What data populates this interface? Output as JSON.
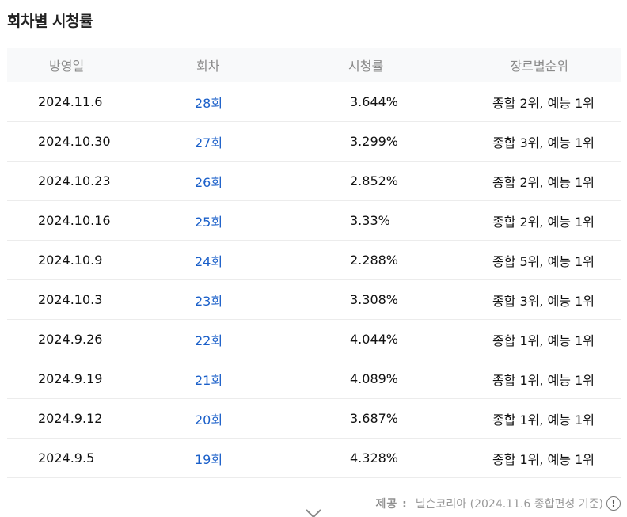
{
  "title": "회차별 시청률",
  "table": {
    "headers": [
      "방영일",
      "회차",
      "시청률",
      "장르별순위"
    ],
    "rows": [
      {
        "date": "2024.11.6",
        "episode": "28회",
        "rating": "3.644%",
        "rank": "종합 2위, 예능 1위"
      },
      {
        "date": "2024.10.30",
        "episode": "27회",
        "rating": "3.299%",
        "rank": "종합 3위, 예능 1위"
      },
      {
        "date": "2024.10.23",
        "episode": "26회",
        "rating": "2.852%",
        "rank": "종합 2위, 예능 1위"
      },
      {
        "date": "2024.10.16",
        "episode": "25회",
        "rating": "3.33%",
        "rank": "종합 2위, 예능 1위"
      },
      {
        "date": "2024.10.9",
        "episode": "24회",
        "rating": "2.288%",
        "rank": "종합 5위, 예능 1위"
      },
      {
        "date": "2024.10.3",
        "episode": "23회",
        "rating": "3.308%",
        "rank": "종합 3위, 예능 1위"
      },
      {
        "date": "2024.9.26",
        "episode": "22회",
        "rating": "4.044%",
        "rank": "종합 1위, 예능 1위"
      },
      {
        "date": "2024.9.19",
        "episode": "21회",
        "rating": "4.089%",
        "rank": "종합 1위, 예능 1위"
      },
      {
        "date": "2024.9.12",
        "episode": "20회",
        "rating": "3.687%",
        "rank": "종합 1위, 예능 1위"
      },
      {
        "date": "2024.9.5",
        "episode": "19회",
        "rating": "4.328%",
        "rank": "종합 1위, 예능 1위"
      }
    ]
  },
  "source": {
    "label": "제공 :",
    "text": "닐슨코리아 (2024.11.6 종합편성 기준)",
    "info_icon": "info-icon"
  },
  "expand_icon": "chevron-down-icon",
  "colors": {
    "link": "#1a5fc9",
    "header_bg": "#f8f9fa",
    "border": "#ececec"
  }
}
